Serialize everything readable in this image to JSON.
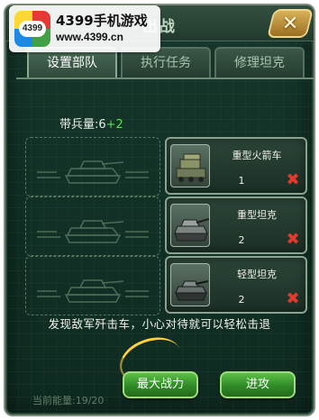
{
  "window": {
    "title": "出战",
    "close_label": "✕"
  },
  "watermark": {
    "badge": "4399",
    "title": "4399手机游戏",
    "url": "www.4399.cn"
  },
  "tabs": [
    {
      "label": "设置部队",
      "active": true
    },
    {
      "label": "执行任务",
      "active": false
    },
    {
      "label": "修理坦克",
      "active": false
    }
  ],
  "troops": {
    "label": "带兵量:6",
    "extra": "+2"
  },
  "units": [
    {
      "name": "重型火箭车",
      "count": "1",
      "icon": "rocket-truck-icon"
    },
    {
      "name": "重型坦克",
      "count": "2",
      "icon": "heavy-tank-icon"
    },
    {
      "name": "轻型坦克",
      "count": "2",
      "icon": "light-tank-icon"
    }
  ],
  "hint": "发现敌军歼击车，小心对待就可以轻松击退",
  "buttons": {
    "max_power": "最大战力",
    "attack": "进攻"
  },
  "footer": {
    "power_text": "当前能量:19/20"
  },
  "colors": {
    "panel": "#123126",
    "button_green": "#2f8a26",
    "remove_red": "#e23a2e",
    "accent_green": "#5fdc52",
    "close_gold": "#d8b25a"
  }
}
